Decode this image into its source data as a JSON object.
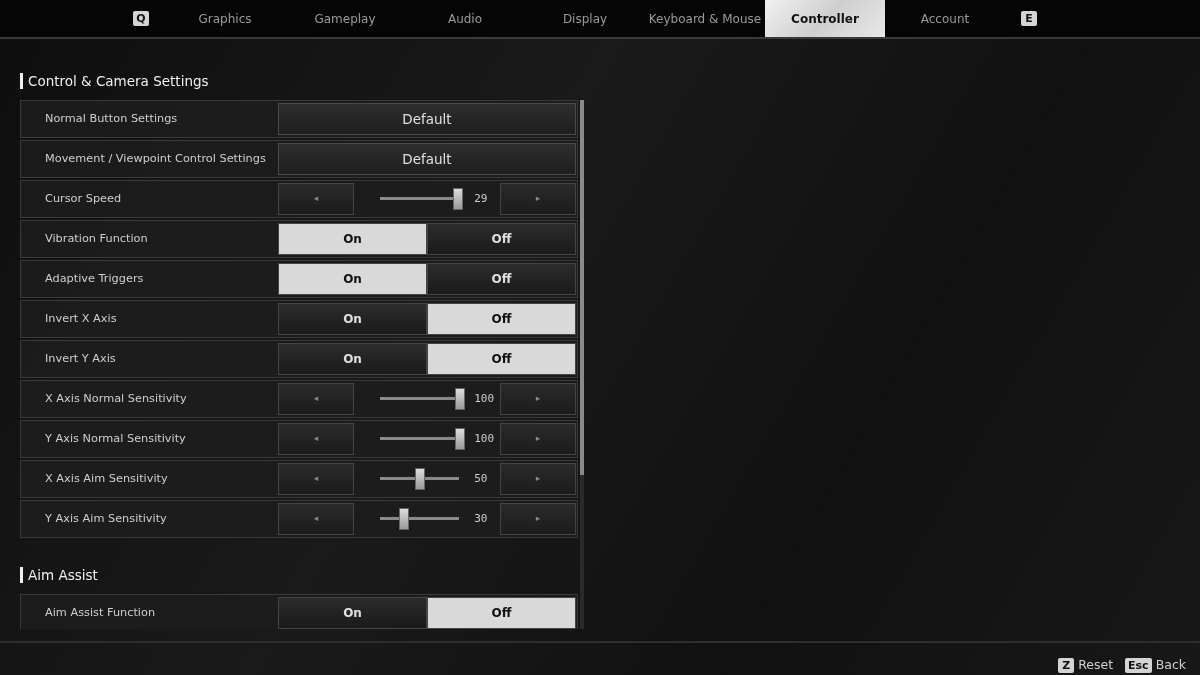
{
  "tab_bar": {
    "prev_key": "Q",
    "next_key": "E",
    "tabs": [
      {
        "label": "Graphics",
        "selected": false
      },
      {
        "label": "Gameplay",
        "selected": false
      },
      {
        "label": "Audio",
        "selected": false
      },
      {
        "label": "Display",
        "selected": false
      },
      {
        "label": "Keyboard & Mouse",
        "selected": false
      },
      {
        "label": "Controller",
        "selected": true
      },
      {
        "label": "Account",
        "selected": false
      }
    ]
  },
  "sections": [
    {
      "title": "Control & Camera Settings",
      "rows": [
        {
          "kind": "select",
          "label": "Normal Button Settings",
          "value": "Default"
        },
        {
          "kind": "select",
          "label": "Movement / Viewpoint Control Settings",
          "value": "Default"
        },
        {
          "kind": "slider",
          "label": "Cursor Speed",
          "level": 0.97,
          "reading": "29",
          "left": "◂",
          "right": "▸"
        },
        {
          "kind": "toggle",
          "label": "Vibration Function",
          "options": [
            {
              "label": "On",
              "selected": true
            },
            {
              "label": "Off",
              "selected": false
            }
          ]
        },
        {
          "kind": "toggle",
          "label": "Adaptive Triggers",
          "options": [
            {
              "label": "On",
              "selected": true
            },
            {
              "label": "Off",
              "selected": false
            }
          ]
        },
        {
          "kind": "toggle",
          "label": "Invert X Axis",
          "options": [
            {
              "label": "On",
              "selected": false
            },
            {
              "label": "Off",
              "selected": true
            }
          ]
        },
        {
          "kind": "toggle",
          "label": "Invert Y Axis",
          "options": [
            {
              "label": "On",
              "selected": false
            },
            {
              "label": "Off",
              "selected": true
            }
          ]
        },
        {
          "kind": "slider",
          "label": "X Axis Normal Sensitivity",
          "level": 1.0,
          "reading": "100",
          "left": "◂",
          "right": "▸"
        },
        {
          "kind": "slider",
          "label": "Y Axis Normal Sensitivity",
          "level": 1.0,
          "reading": "100",
          "left": "◂",
          "right": "▸"
        },
        {
          "kind": "slider",
          "label": "X Axis Aim Sensitivity",
          "level": 0.5,
          "reading": "50",
          "left": "◂",
          "right": "▸"
        },
        {
          "kind": "slider",
          "label": "Y Axis Aim Sensitivity",
          "level": 0.3,
          "reading": "30",
          "left": "◂",
          "right": "▸"
        }
      ]
    },
    {
      "title": "Aim Assist",
      "rows": [
        {
          "kind": "toggle",
          "label": "Aim Assist Function",
          "options": [
            {
              "label": "On",
              "selected": false
            },
            {
              "label": "Off",
              "selected": true
            }
          ]
        }
      ]
    }
  ],
  "footer": {
    "hints": [
      {
        "key": "Z",
        "label": "Reset"
      },
      {
        "key": "Esc",
        "label": "Back"
      }
    ]
  }
}
